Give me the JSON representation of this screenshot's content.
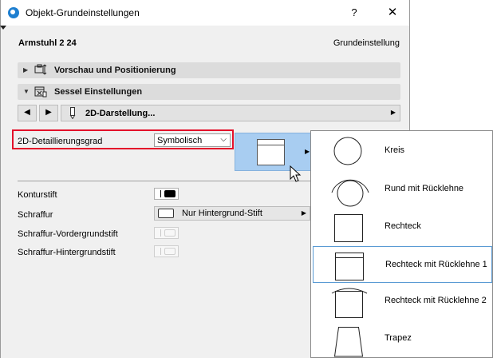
{
  "window": {
    "title": "Objekt-Grundeinstellungen",
    "help": "?",
    "close": "✕"
  },
  "header": {
    "object_name": "Armstuhl 2 24",
    "mode": "Grundeinstellung"
  },
  "sections": [
    {
      "label": "Vorschau und Positionierung",
      "expanded": false,
      "icon": "preview-position-icon"
    },
    {
      "label": "Sessel Einstellungen",
      "expanded": true,
      "icon": "chair-settings-icon"
    }
  ],
  "nav": {
    "prev": "◀",
    "next": "▶",
    "page_label": "2D-Darstellung...",
    "page_icon": "pen-icon",
    "more": "▶"
  },
  "detail": {
    "label": "2D-Detaillierungsgrad",
    "value": "Symbolisch",
    "highlight_color": "#e3102a"
  },
  "preview": {
    "arrow": "▶",
    "selected_symbol": "Rechteck mit Rücklehne 1"
  },
  "pens": {
    "contour_label": "Konturstift",
    "fill_label": "Schraffur",
    "fill_value": "Nur Hintergrund-Stift",
    "fill_fg_label": "Schraffur-Vordergrundstift",
    "fill_bg_label": "Schraffur-Hintergrundstift"
  },
  "popup": {
    "items": [
      {
        "label": "Kreis",
        "shape": "circle"
      },
      {
        "label": "Rund mit Rücklehne",
        "shape": "circle-back"
      },
      {
        "label": "Rechteck",
        "shape": "rect"
      },
      {
        "label": "Rechteck mit Rücklehne 1",
        "shape": "rect-back",
        "selected": true
      },
      {
        "label": "Rechteck mit Rücklehne 2",
        "shape": "rect-arc"
      },
      {
        "label": "Trapez",
        "shape": "trapezoid"
      }
    ]
  },
  "colors": {
    "accent": "#a8cdf1",
    "selection": "#5a9bd4",
    "section_bg": "#dcdcdc",
    "dialog_bg": "#f0f0f0"
  }
}
